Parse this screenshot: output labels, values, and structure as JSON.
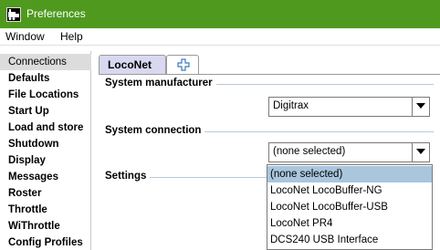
{
  "window": {
    "title": "Preferences"
  },
  "menu": {
    "items": [
      "Window",
      "Help"
    ]
  },
  "sidebar": {
    "selected_index": 0,
    "items": [
      "Connections",
      "Defaults",
      "File Locations",
      "Start Up",
      "Load and store",
      "Shutdown",
      "Display",
      "Messages",
      "Roster",
      "Throttle",
      "WiThrottle",
      "Config Profiles"
    ]
  },
  "tabs": {
    "active": "LocoNet",
    "add_icon": "plus-icon"
  },
  "sections": {
    "system_manufacturer": {
      "label": "System manufacturer",
      "value": "Digitrax"
    },
    "system_connection": {
      "label": "System connection",
      "value": "(none selected)"
    },
    "settings": {
      "label": "Settings"
    }
  },
  "connection_dropdown": {
    "selected_index": 0,
    "options": [
      "(none selected)",
      "LocoNet LocoBuffer-NG",
      "LocoNet LocoBuffer-USB",
      "LocoNet PR4",
      "DCS240 USB Interface"
    ]
  },
  "colors": {
    "titlebar": "#4f9a1e",
    "selection": "#a9c6dd",
    "active_tab": "#d8d8f0"
  }
}
